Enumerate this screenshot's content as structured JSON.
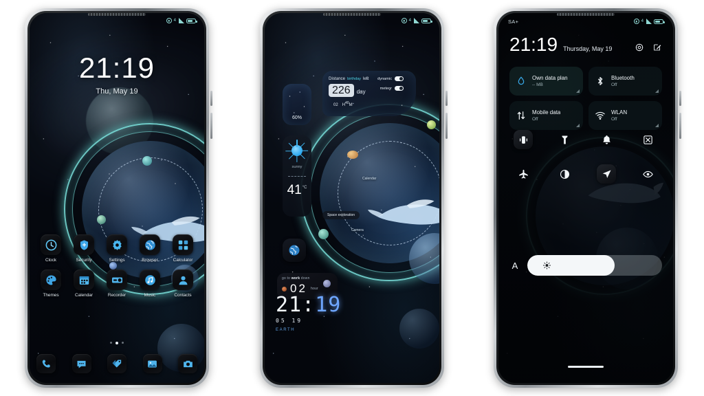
{
  "scene": {
    "background_color": "#ffffff",
    "device_count": 3,
    "theme_accent": "#6ee1dc"
  },
  "phone1": {
    "statusbar": {
      "icons": [
        "alarm-icon",
        "signal-icon",
        "battery-icon"
      ],
      "tick": "4"
    },
    "lockscreen": {
      "time": "21:19",
      "date": "Thu, May 19"
    },
    "apps_row1": [
      {
        "label": "Clock",
        "icon": "clock-icon"
      },
      {
        "label": "Security",
        "icon": "shield-icon"
      },
      {
        "label": "Settings",
        "icon": "gear-icon"
      },
      {
        "label": "Browser",
        "icon": "globe-icon"
      },
      {
        "label": "Calculator",
        "icon": "calculator-icon"
      }
    ],
    "apps_row2": [
      {
        "label": "Themes",
        "icon": "palette-icon"
      },
      {
        "label": "Calendar",
        "icon": "calendar-icon"
      },
      {
        "label": "Recorder",
        "icon": "recorder-icon"
      },
      {
        "label": "Music",
        "icon": "music-note-icon"
      },
      {
        "label": "Contacts",
        "icon": "contact-person-icon"
      }
    ],
    "page_dots": {
      "count": 3,
      "active_index": 1
    },
    "dock": [
      {
        "name": "phone-icon"
      },
      {
        "name": "messages-icon"
      },
      {
        "name": "themes-tag-icon"
      },
      {
        "name": "gallery-icon"
      },
      {
        "name": "camera-icon"
      }
    ]
  },
  "phone2": {
    "statusbar": {
      "icons": [
        "alarm-icon",
        "signal-icon",
        "battery-icon"
      ],
      "tick": "4"
    },
    "battery_widget": {
      "value": "60%"
    },
    "weather_widget": {
      "condition": "sunny",
      "temperature": "41",
      "unit": "°C",
      "icon": "sun-icon"
    },
    "earth_widget": {
      "icon": "earth-icon"
    },
    "countdown_widget": {
      "title_prefix": "go to ",
      "title_bold": "work",
      "title_suffix": " down",
      "value": "02",
      "unit": "hour"
    },
    "distance_widget": {
      "label_prefix": "Distance",
      "label_highlight": "birthday",
      "label_suffix": "left",
      "value": "226",
      "unit": "day",
      "hours": "02",
      "hours_unit": "H",
      "minutes": "40",
      "minutes_unit": "M",
      "switches": [
        {
          "label": "dynamic",
          "state": "on"
        },
        {
          "label": "meteor",
          "state": "on"
        }
      ]
    },
    "orbit_labels": [
      {
        "text": "Space exploration",
        "style": "chip"
      },
      {
        "text": "Calendar",
        "style": "plain"
      },
      {
        "text": "Camera",
        "style": "plain"
      }
    ],
    "clock_widget": {
      "hours": "21",
      "separator": ":",
      "minutes": "19",
      "date": "05  19",
      "subtitle": "EARTH"
    }
  },
  "phone3": {
    "statusbar": {
      "carrier": "SA+",
      "icons": [
        "alarm-icon",
        "signal-icon",
        "battery-icon"
      ],
      "tick": "4"
    },
    "header": {
      "time": "21:19",
      "date": "Thursday, May 19",
      "icons": [
        "settings-gear-icon",
        "edit-pencil-icon"
      ]
    },
    "tiles": [
      {
        "title": "Own data plan",
        "subtitle": "-- MB",
        "icon": "data-drop-icon",
        "state": "on"
      },
      {
        "title": "Bluetooth",
        "subtitle": "Off",
        "icon": "bluetooth-icon",
        "state": "off"
      },
      {
        "title": "Mobile data",
        "subtitle": "Off",
        "icon": "mobile-data-icon",
        "state": "off"
      },
      {
        "title": "WLAN",
        "subtitle": "Off",
        "icon": "wifi-icon",
        "state": "off"
      }
    ],
    "toggles_row1": [
      {
        "name": "vibrate-icon",
        "active": true
      },
      {
        "name": "flashlight-icon",
        "active": false
      },
      {
        "name": "ringer-bell-icon",
        "active": false
      },
      {
        "name": "screenshot-icon",
        "active": false
      }
    ],
    "toggles_row2": [
      {
        "name": "airplane-mode-icon",
        "active": false
      },
      {
        "name": "dark-mode-icon",
        "active": false
      },
      {
        "name": "location-icon",
        "active": true
      },
      {
        "name": "eye-comfort-icon",
        "active": false
      }
    ],
    "brightness": {
      "auto_label": "A",
      "icon": "brightness-sun-icon",
      "percent": 65
    }
  }
}
